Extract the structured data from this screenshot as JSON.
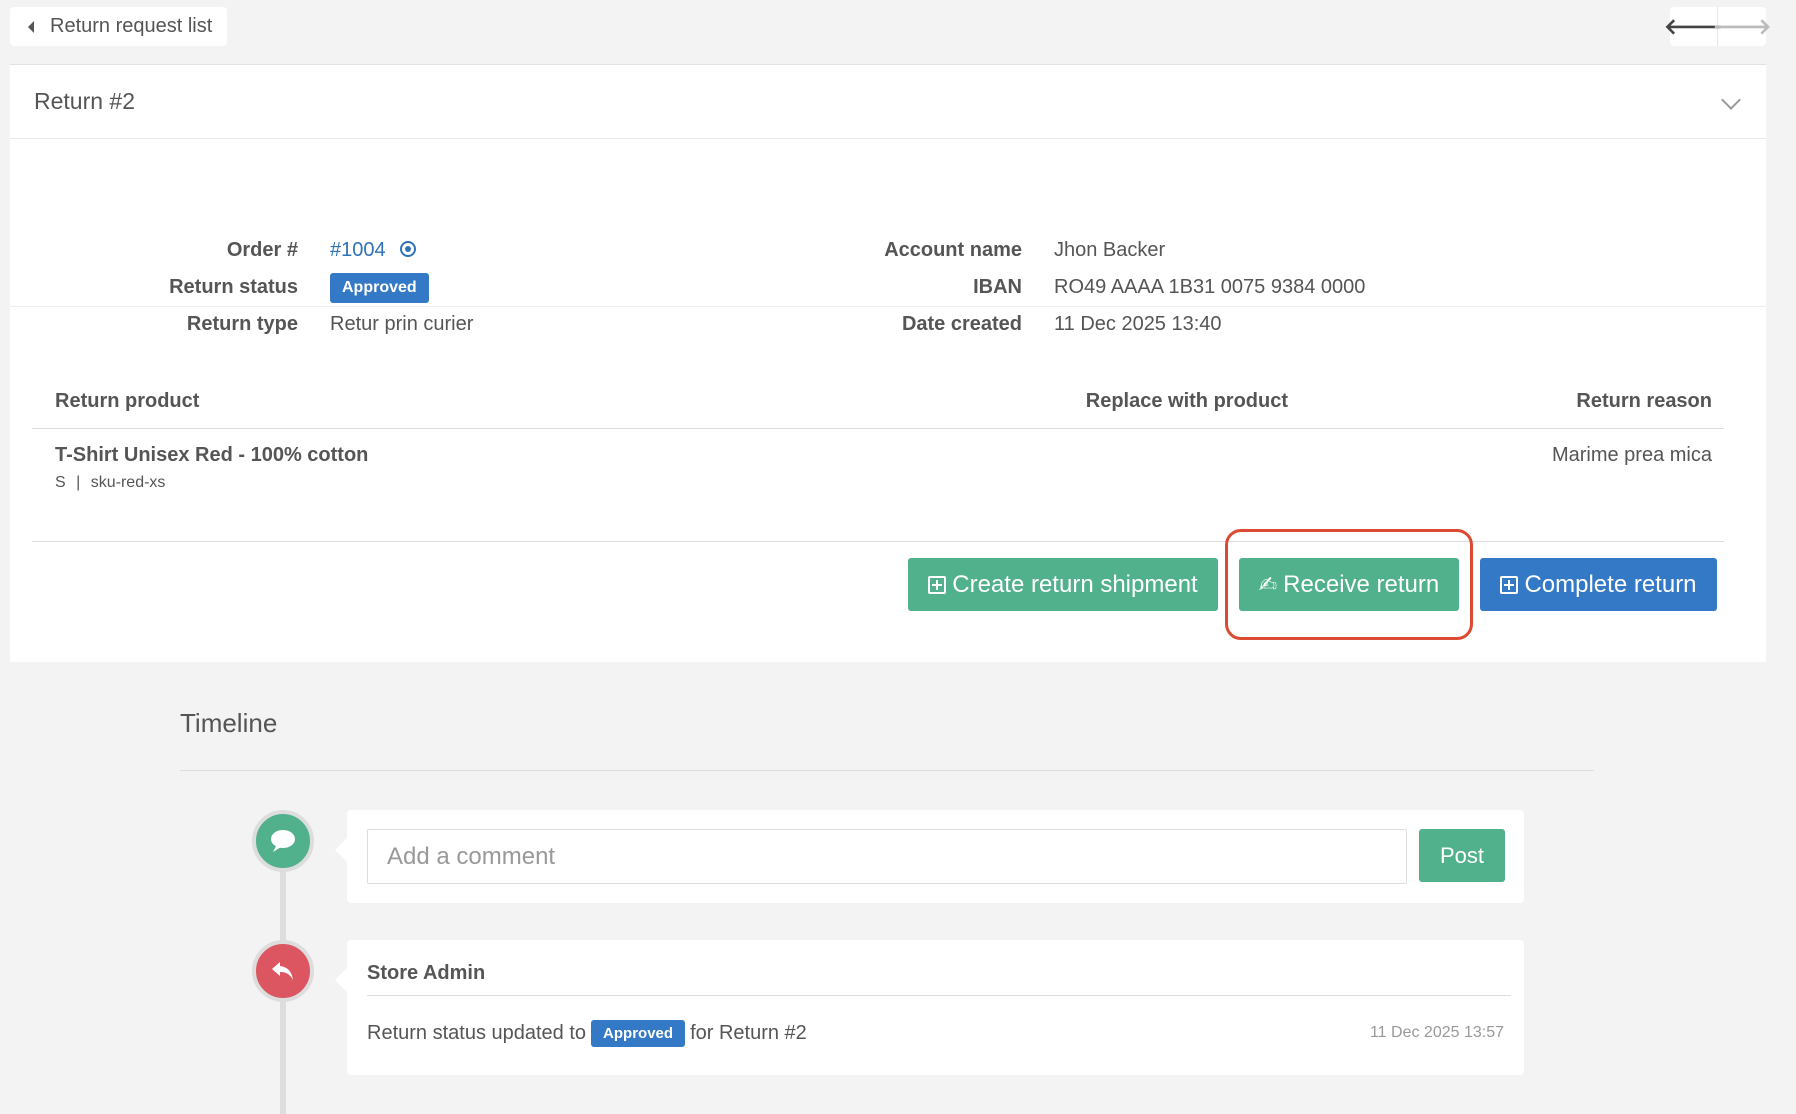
{
  "topbar": {
    "back_label": "Return request list"
  },
  "panel": {
    "title": "Return #2"
  },
  "info": {
    "order_label": "Order #",
    "order_value": "#1004",
    "status_label": "Return status",
    "status_value": "Approved",
    "type_label": "Return type",
    "type_value": "Retur prin curier",
    "account_label": "Account name",
    "account_value": "Jhon Backer",
    "iban_label": "IBAN",
    "iban_value": "RO49 AAAA 1B31 0075 9384 0000",
    "date_label": "Date created",
    "date_value": "11 Dec 2025 13:40"
  },
  "table": {
    "headers": [
      "Return product",
      "Replace with product",
      "Return reason"
    ],
    "rows": [
      {
        "product": "T-Shirt Unisex Red - 100% cotton",
        "size": "S",
        "sku": "sku-red-xs",
        "replacement": "",
        "reason": "Marime prea mica"
      }
    ]
  },
  "actions": {
    "create_shipment": "Create return shipment",
    "receive": "Receive return",
    "complete": "Complete return"
  },
  "timeline": {
    "title": "Timeline",
    "comment_placeholder": "Add a comment",
    "post_label": "Post",
    "entries": [
      {
        "author": "Store Admin",
        "text_before": "Return status updated to",
        "badge": "Approved",
        "text_after": "for Return #2",
        "timestamp": "11 Dec 2025 13:57"
      }
    ]
  },
  "colors": {
    "green": "#51b18d",
    "blue": "#3479c6",
    "red": "#db5661",
    "highlight": "#dc4a32"
  }
}
